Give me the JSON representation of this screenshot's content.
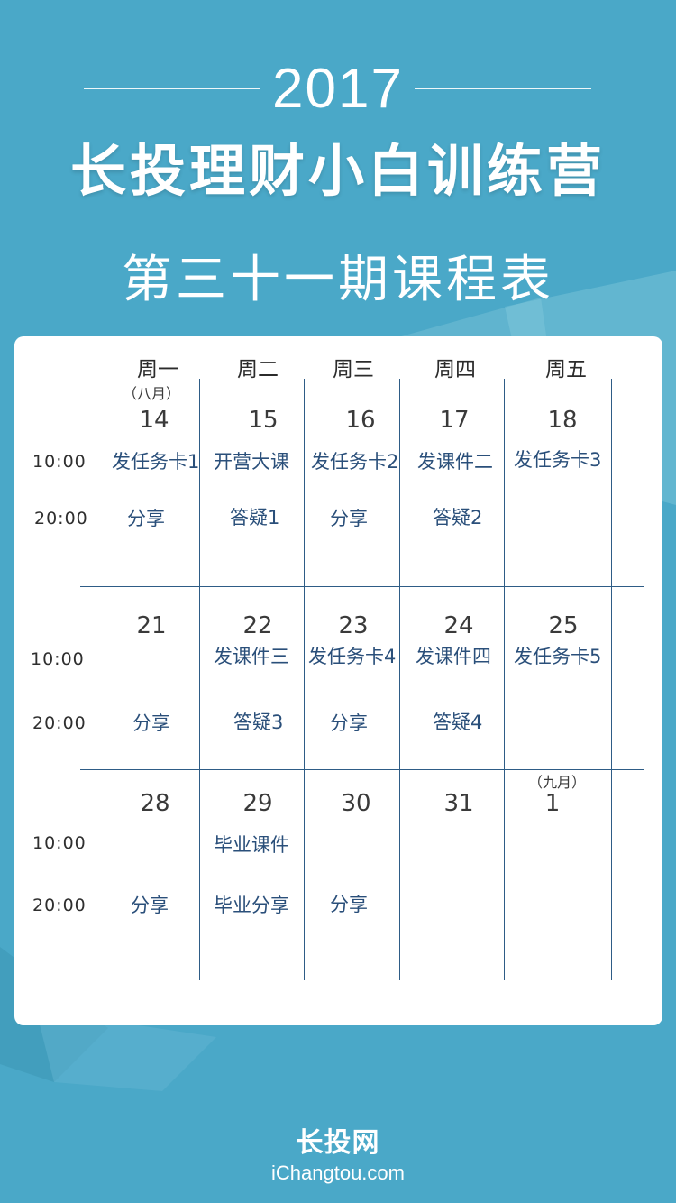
{
  "header": {
    "year": "2017",
    "title": "长投理财小白训练营",
    "subtitle": "第三十一期课程表"
  },
  "weekdays": [
    "周一",
    "周二",
    "周三",
    "周四",
    "周五"
  ],
  "months": {
    "august": "（八月）",
    "september": "（九月）"
  },
  "times": {
    "morning": "10:00",
    "evening": "20:00"
  },
  "weeks": [
    {
      "dates": [
        "14",
        "15",
        "16",
        "17",
        "18"
      ],
      "morning": [
        "发任务卡1",
        "开营大课",
        "发任务卡2",
        "发课件二",
        "发任务卡3"
      ],
      "evening": [
        "分享",
        "答疑1",
        "分享",
        "答疑2",
        ""
      ]
    },
    {
      "dates": [
        "21",
        "22",
        "23",
        "24",
        "25"
      ],
      "morning": [
        "",
        "发课件三",
        "发任务卡4",
        "发课件四",
        "发任务卡5"
      ],
      "evening": [
        "分享",
        "答疑3",
        "分享",
        "答疑4",
        ""
      ]
    },
    {
      "dates": [
        "28",
        "29",
        "30",
        "31",
        "1"
      ],
      "morning": [
        "",
        "毕业课件",
        "",
        "",
        ""
      ],
      "evening": [
        "分享",
        "毕业分享",
        "分享",
        "",
        ""
      ]
    }
  ],
  "footer": {
    "logo_cn": "长投网",
    "logo_en": "iChangtou.com"
  },
  "colors": {
    "background": "#4aa8c8",
    "card": "#ffffff",
    "text": "#2a4f7a",
    "grid": "#2e5c86"
  }
}
